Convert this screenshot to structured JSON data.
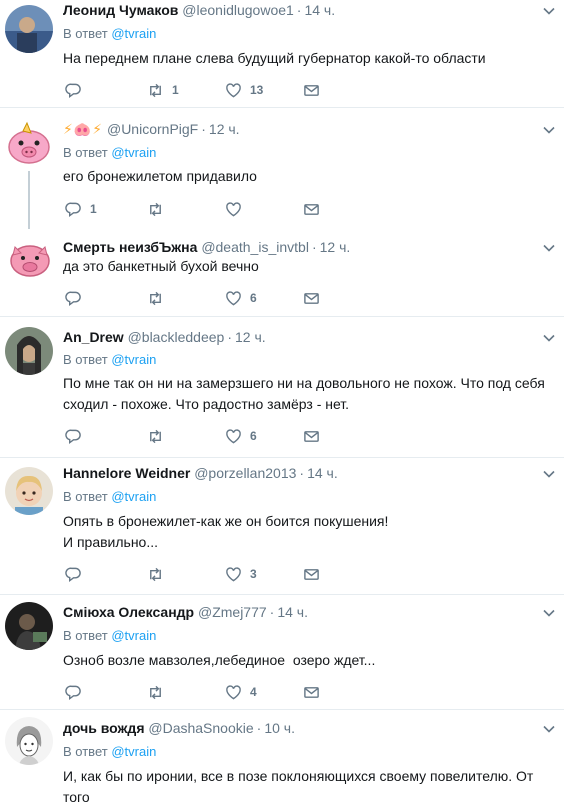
{
  "reply_prefix": "В ответ",
  "reply_link": "@tvrain",
  "tweets": [
    {
      "name": "Леонид Чумаков",
      "handle": "@leonidlugowoe1",
      "sep": "·",
      "time": "14 ч.",
      "text": "На переднем плане слева будущий губернатор какой-то области",
      "replies": "",
      "retweets": "1",
      "likes": "13",
      "avatar_icon": "avatar-photo-landscape",
      "avatar_color": "#3b5b8a"
    },
    {
      "emojis": "⚡🐽⚡",
      "name": "",
      "handle": "@UnicornPigF",
      "sep": "·",
      "time": "12 ч.",
      "text": "его бронежилетом придавило",
      "replies": "1",
      "retweets": "",
      "likes": "",
      "avatar_icon": "avatar-unicorn-pig",
      "avatar_color": "#f7a8c8"
    },
    {
      "name": "Смерть неизбЪжна",
      "handle": "@death_is_invtbl",
      "sep": "·",
      "time": "12 ч.",
      "text": "да это банкетный бухой вечно",
      "replies": "",
      "retweets": "",
      "likes": "6",
      "avatar_icon": "avatar-pink-pig",
      "avatar_color": "#f49ab5"
    },
    {
      "name": "An_Drew",
      "handle": "@blackleddeep",
      "sep": "·",
      "time": "12 ч.",
      "text": "По мне так он ни на замерзшего ни на довольного не похож. Что под себя\nсходил - похоже. Что радостно замёрз - нет.",
      "replies": "",
      "retweets": "",
      "likes": "6",
      "avatar_icon": "avatar-portrait-dark",
      "avatar_color": "#4a4a4a"
    },
    {
      "name": "Hannelore Weidner",
      "handle": "@porzellan2013",
      "sep": "·",
      "time": "14 ч.",
      "text": "Опять в бронежилет-как же он боится покушения!\nИ правильно...",
      "replies": "",
      "retweets": "",
      "likes": "3",
      "avatar_icon": "avatar-child-photo",
      "avatar_color": "#d9b99b"
    },
    {
      "name": "Сміюха Олександр",
      "handle": "@Zmej777",
      "sep": "·",
      "time": "14 ч.",
      "text": "Озноб возле мавзолея,лебединое  озеро ждет...",
      "replies": "",
      "retweets": "",
      "likes": "4",
      "avatar_icon": "avatar-dark-photo",
      "avatar_color": "#2c2c2c"
    },
    {
      "name": "дочь вождя",
      "handle": "@DashaSnookie",
      "sep": "·",
      "time": "10 ч.",
      "text": "И, как бы по иронии, все в позе поклоняющихся своему повелителю. От того\nи довольный такой...",
      "replies": "",
      "retweets": "",
      "likes": "",
      "avatar_icon": "avatar-sketch-girl",
      "avatar_color": "#e8e8e8"
    }
  ]
}
